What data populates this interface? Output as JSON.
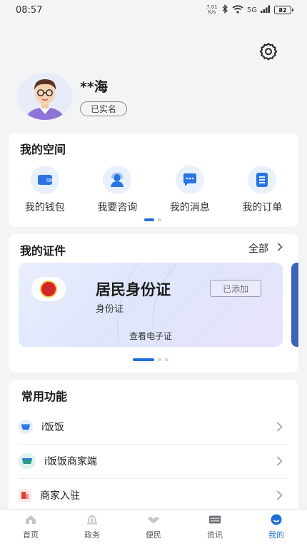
{
  "status_bar": {
    "time": "08:57",
    "net_speed_value": "7.01",
    "net_speed_unit": "K/s",
    "network": "5G",
    "battery": "82"
  },
  "profile": {
    "name": "**海",
    "verified_badge": "已实名"
  },
  "my_space": {
    "title": "我的空间",
    "items": [
      {
        "label": "我的钱包",
        "icon": "wallet-icon"
      },
      {
        "label": "我要咨询",
        "icon": "consult-icon"
      },
      {
        "label": "我的消息",
        "icon": "message-icon"
      },
      {
        "label": "我的订单",
        "icon": "order-icon"
      }
    ],
    "page_count": 2,
    "active_page": 1
  },
  "certificates": {
    "title": "我的证件",
    "all_link": "全部",
    "card": {
      "title": "居民身份证",
      "subtitle": "身份证",
      "status": "已添加",
      "action": "查看电子证"
    },
    "page_count": 3,
    "active_page": 1
  },
  "functions": {
    "title": "常用功能",
    "items": [
      {
        "label": "i饭饭",
        "icon": "ifanfan-icon"
      },
      {
        "label": "i饭饭商家端",
        "icon": "merchant-app-icon"
      },
      {
        "label": "商家入驻",
        "icon": "merchant-join-icon"
      }
    ]
  },
  "tabbar": {
    "tabs": [
      {
        "label": "首页",
        "icon": "home-icon",
        "active": false
      },
      {
        "label": "政务",
        "icon": "government-icon",
        "active": false
      },
      {
        "label": "便民",
        "icon": "convenience-icon",
        "active": false
      },
      {
        "label": "资讯",
        "icon": "news-icon",
        "active": false
      },
      {
        "label": "我的",
        "icon": "profile-icon",
        "active": true
      }
    ]
  },
  "colors": {
    "accent": "#1e6fd9",
    "background": "#f3f4f6"
  }
}
